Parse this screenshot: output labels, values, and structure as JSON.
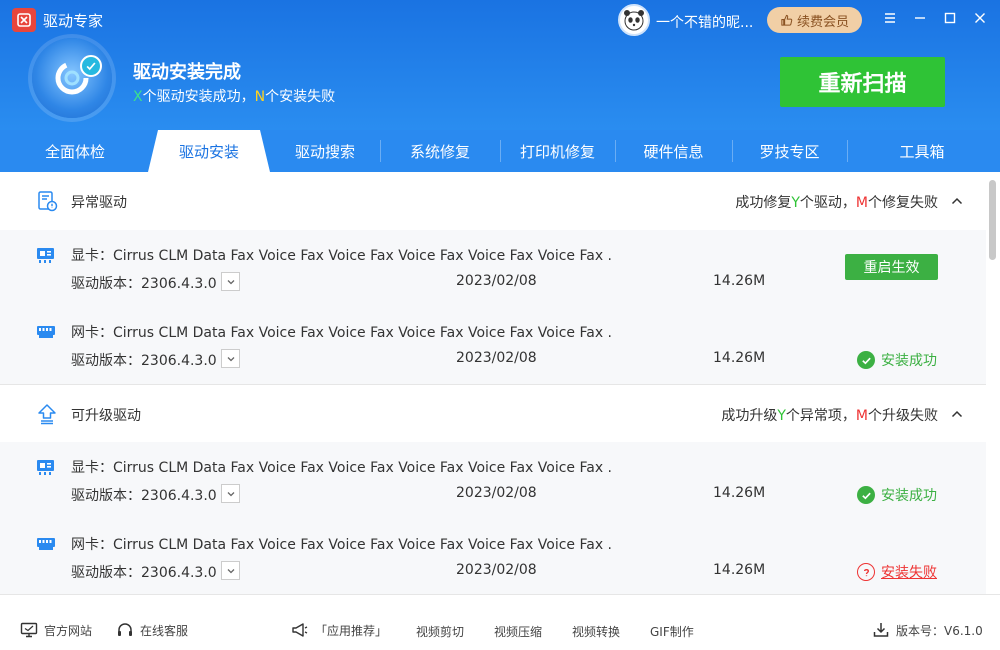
{
  "app": {
    "name": "驱动专家"
  },
  "user": {
    "name": "一个不错的昵...",
    "vip_label": "续费会员"
  },
  "hero": {
    "title": "驱动安装完成",
    "summary_x": "X",
    "summary_mid": "个驱动安装成功，",
    "summary_n": "N",
    "summary_end": "个安装失败",
    "rescan_label": "重新扫描"
  },
  "tabs": [
    {
      "label": "全面体检"
    },
    {
      "label": "驱动安装"
    },
    {
      "label": "驱动搜索"
    },
    {
      "label": "系统修复"
    },
    {
      "label": "打印机修复"
    },
    {
      "label": "硬件信息"
    },
    {
      "label": "罗技专区"
    },
    {
      "label": "工具箱"
    }
  ],
  "active_tab": "驱动安装",
  "sections": [
    {
      "title": "异常驱动",
      "status_a": "成功修复",
      "status_y": "Y",
      "status_b": "个驱动，",
      "status_m": "M",
      "status_c": "个修复失败",
      "rows": [
        {
          "type_icon": "display-card-icon",
          "name": "显卡：Cirrus CLM Data Fax Voice Fax Voice Fax Voice Fax Voice Fax Voice Fax ...",
          "version": "驱动版本：2306.4.3.0",
          "date": "2023/02/08",
          "size": "14.26M",
          "action": "重启生效"
        },
        {
          "type_icon": "network-card-icon",
          "name": "网卡：Cirrus CLM Data Fax Voice Fax Voice Fax Voice Fax Voice Fax Voice Fax ...",
          "version": "驱动版本：2306.4.3.0",
          "date": "2023/02/08",
          "size": "14.26M",
          "status": "安装成功"
        }
      ]
    },
    {
      "title": "可升级驱动",
      "status_a": "成功升级",
      "status_y": "Y",
      "status_b": "个异常项，",
      "status_m": "M",
      "status_c": "个升级失败",
      "rows": [
        {
          "type_icon": "display-card-icon",
          "name": "显卡：Cirrus CLM Data Fax Voice Fax Voice Fax Voice Fax Voice Fax Voice Fax ...",
          "version": "驱动版本：2306.4.3.0",
          "date": "2023/02/08",
          "size": "14.26M",
          "status": "安装成功"
        },
        {
          "type_icon": "network-card-icon",
          "name": "网卡：Cirrus CLM Data Fax Voice Fax Voice Fax Voice Fax Voice Fax Voice Fax ...",
          "version": "驱动版本：2306.4.3.0",
          "date": "2023/02/08",
          "size": "14.26M",
          "status": "安装失败"
        }
      ]
    }
  ],
  "footer": {
    "website": "官方网站",
    "support": "在线客服",
    "recommend": "「应用推荐」",
    "video_cut": "视频剪切",
    "video_compress": "视频压缩",
    "video_convert": "视频转换",
    "gif": "GIF制作",
    "version": "版本号：V6.1.0"
  },
  "colors": {
    "header": "#1a73e2",
    "accent_green": "#2fc336",
    "fail_red": "#e33333",
    "vip_gold": "#f1cfa6"
  }
}
